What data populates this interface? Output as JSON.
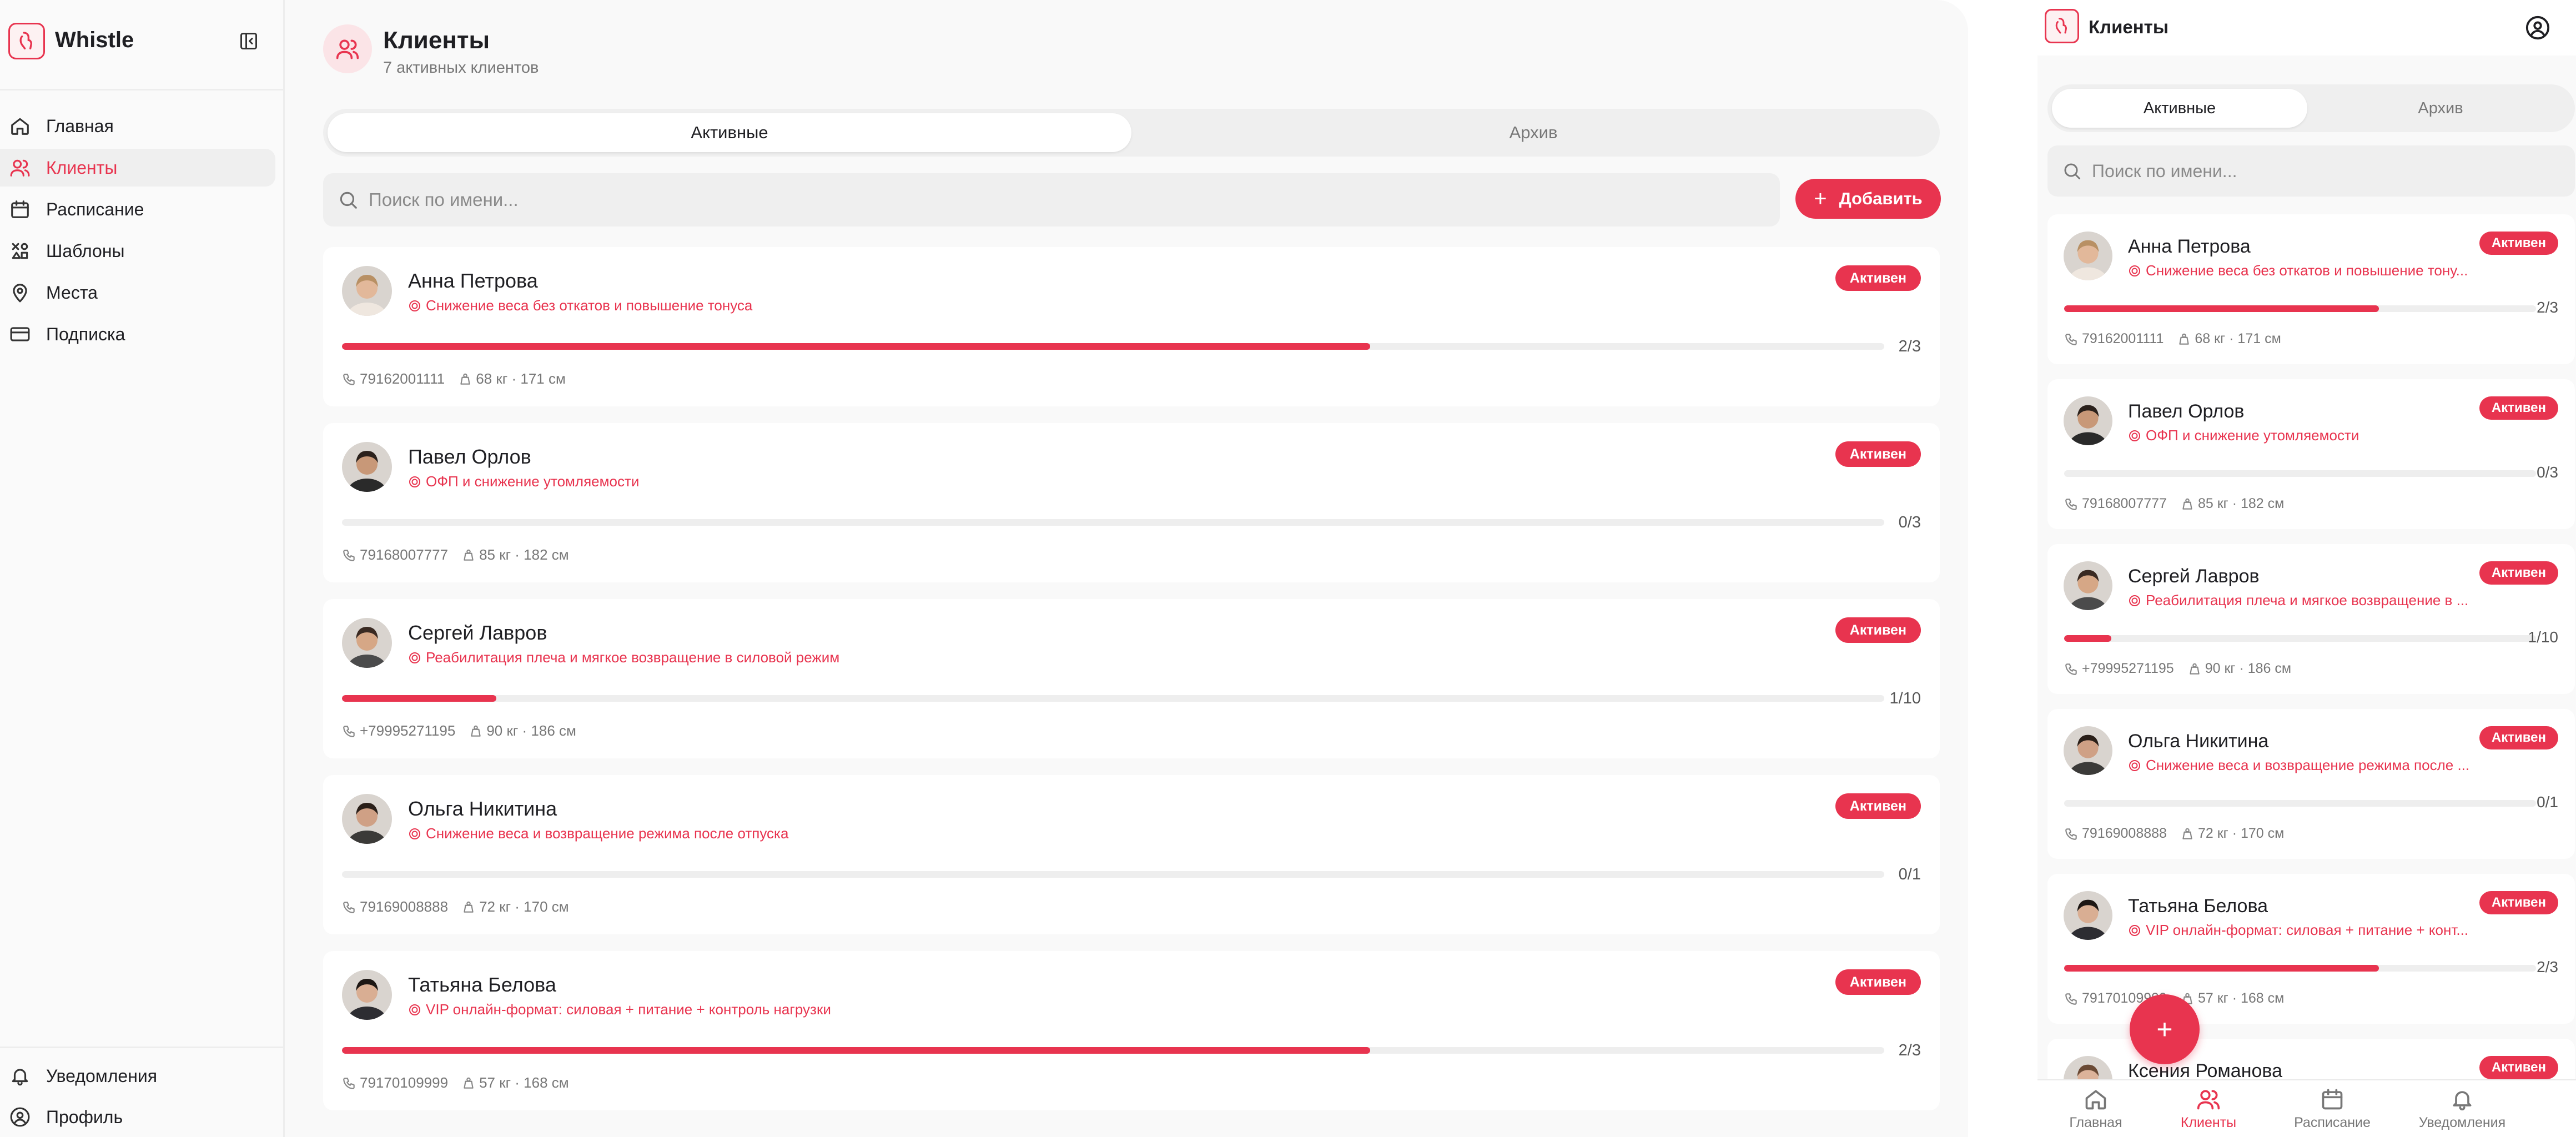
{
  "app": {
    "name": "Whistle"
  },
  "sidebar": {
    "items": [
      {
        "label": "Главная",
        "icon": "home-icon",
        "active": false
      },
      {
        "label": "Клиенты",
        "icon": "users-icon",
        "active": true
      },
      {
        "label": "Расписание",
        "icon": "calendar-icon",
        "active": false
      },
      {
        "label": "Шаблоны",
        "icon": "templates-icon",
        "active": false
      },
      {
        "label": "Места",
        "icon": "location-pin-icon",
        "active": false
      },
      {
        "label": "Подписка",
        "icon": "credit-card-icon",
        "active": false
      }
    ],
    "bottom": [
      {
        "label": "Уведомления",
        "icon": "bell-icon"
      },
      {
        "label": "Профиль",
        "icon": "user-circle-icon"
      }
    ]
  },
  "page": {
    "title": "Клиенты",
    "subtitle": "7 активных клиентов",
    "tabs": [
      {
        "label": "Активные",
        "active": true
      },
      {
        "label": "Архив",
        "active": false
      }
    ],
    "search": {
      "placeholder": "Поиск по имени..."
    },
    "add_label": "Добавить"
  },
  "clients": [
    {
      "name": "Анна Петрова",
      "goal": "Снижение веса без откатов и повышение тонуса",
      "goal_short": "Снижение веса без откатов и повышение тону...",
      "status": "Активен",
      "done": 2,
      "total": 3,
      "progress_text": "2/3",
      "phone": "79162001111",
      "body": "68 кг · 171 см"
    },
    {
      "name": "Павел Орлов",
      "goal": "ОФП и снижение утомляемости",
      "goal_short": "ОФП и снижение утомляемости",
      "status": "Активен",
      "done": 0,
      "total": 3,
      "progress_text": "0/3",
      "phone": "79168007777",
      "body": "85 кг · 182 см"
    },
    {
      "name": "Сергей Лавров",
      "goal": "Реабилитация плеча и мягкое возвращение в силовой режим",
      "goal_short": "Реабилитация плеча и мягкое возвращение в ...",
      "status": "Активен",
      "done": 1,
      "total": 10,
      "progress_text": "1/10",
      "phone": "+79995271195",
      "body": "90 кг · 186 см"
    },
    {
      "name": "Ольга Никитина",
      "goal": "Снижение веса и возвращение режима после отпуска",
      "goal_short": "Снижение веса и возвращение режима после ...",
      "status": "Активен",
      "done": 0,
      "total": 1,
      "progress_text": "0/1",
      "phone": "79169008888",
      "body": "72 кг · 170 см"
    },
    {
      "name": "Татьяна Белова",
      "goal": "VIP онлайн-формат: силовая + питание + контроль нагрузки",
      "goal_short": "VIP онлайн-формат: силовая + питание + конт...",
      "status": "Активен",
      "done": 2,
      "total": 3,
      "progress_text": "2/3",
      "phone": "79170109999",
      "body": "57 кг · 168 см"
    },
    {
      "name": "Ксения Романова",
      "goal": "",
      "goal_short": "",
      "status": "Активен",
      "done": 0,
      "total": 0,
      "progress_text": "",
      "phone": "",
      "body": ""
    }
  ],
  "mobile": {
    "title": "Клиенты",
    "bottom_nav": [
      {
        "label": "Главная",
        "icon": "home-icon",
        "active": false
      },
      {
        "label": "Клиенты",
        "icon": "users-icon",
        "active": true
      },
      {
        "label": "Расписание",
        "icon": "calendar-icon",
        "active": false
      },
      {
        "label": "Уведомления",
        "icon": "bell-icon",
        "active": false
      }
    ],
    "fab_label": "+"
  },
  "colors": {
    "accent": "#e8344f",
    "accent_light": "#fbe4e7",
    "background": "#f9f9f9",
    "card": "#ffffff",
    "muted": "#777777"
  }
}
